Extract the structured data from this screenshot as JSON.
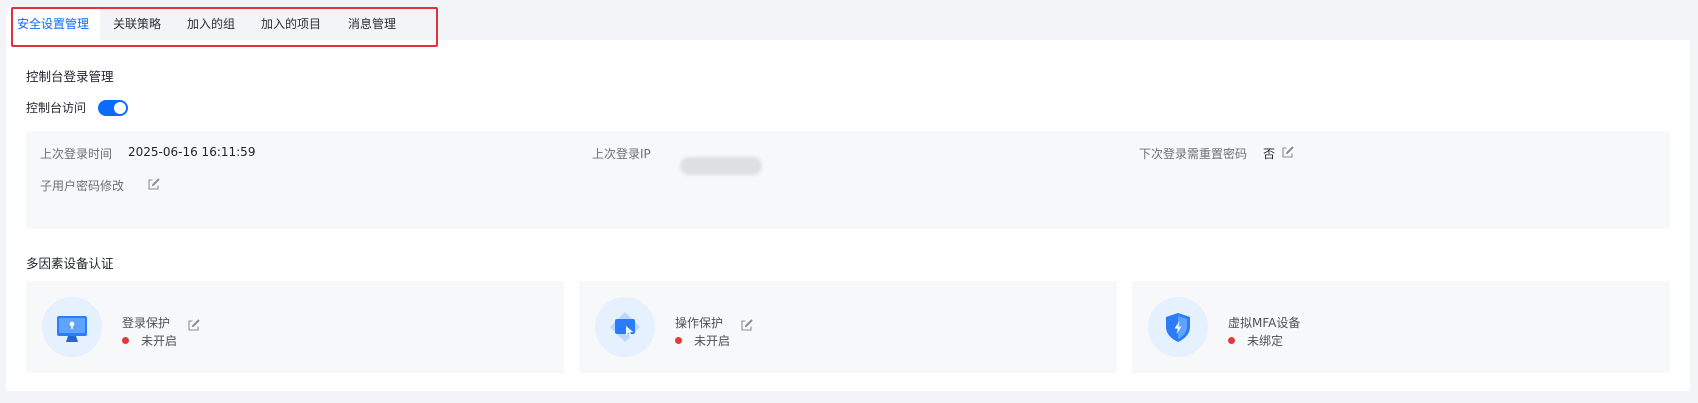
{
  "tabs": [
    {
      "label": "安全设置管理",
      "active": true
    },
    {
      "label": "关联策略",
      "active": false
    },
    {
      "label": "加入的组",
      "active": false
    },
    {
      "label": "加入的项目",
      "active": false
    },
    {
      "label": "消息管理",
      "active": false
    }
  ],
  "console_login": {
    "title": "控制台登录管理",
    "access_label": "控制台访问",
    "access_enabled": true
  },
  "login_info": {
    "last_login_time_label": "上次登录时间",
    "last_login_time_value": "2025-06-16 16:11:59",
    "last_login_ip_label": "上次登录IP",
    "reset_password_label": "下次登录需重置密码",
    "reset_password_value": "否",
    "sub_user_password_label": "子用户密码修改"
  },
  "mfa": {
    "title": "多因素设备认证",
    "cards": [
      {
        "name": "登录保护",
        "status": "未开启",
        "icon": "monitor-lock-icon"
      },
      {
        "name": "操作保护",
        "status": "未开启",
        "icon": "cursor-screen-icon"
      },
      {
        "name": "虚拟MFA设备",
        "status": "未绑定",
        "icon": "shield-bolt-icon"
      }
    ]
  },
  "colors": {
    "accent": "#0a6cff",
    "status_red": "#e5383b",
    "highlight_border": "#e0313f"
  }
}
